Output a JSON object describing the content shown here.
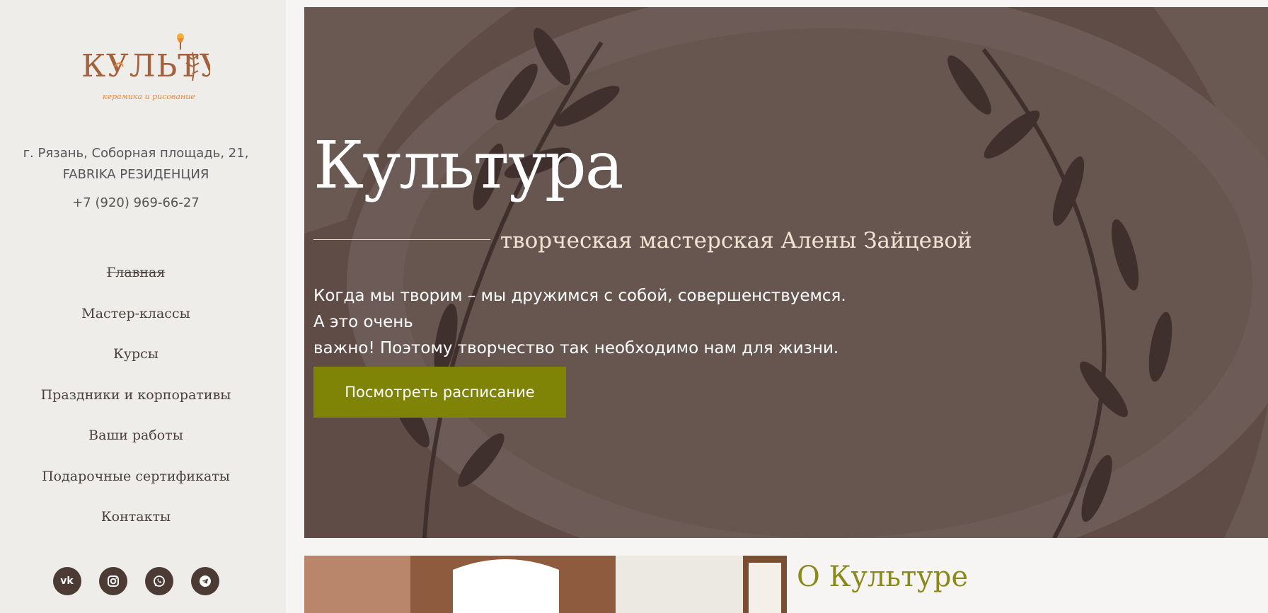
{
  "logo": {
    "text": "КУЛЬТУРА",
    "tagline": "керамика и рисование",
    "colors": {
      "main": "#a3623c",
      "tagline": "#e8893c",
      "accent": "#f2b134"
    }
  },
  "contacts": {
    "address_line1": "г. Рязань, Соборная площадь, 21,",
    "address_line2": "FABRIKA РЕЗИДЕНЦИЯ",
    "phone": "+7 (920) 969-66-27"
  },
  "nav": {
    "items": [
      {
        "label": "Главная",
        "active": true
      },
      {
        "label": "Мастер-классы",
        "active": false
      },
      {
        "label": "Курсы",
        "active": false
      },
      {
        "label": "Праздники и корпоративы",
        "active": false
      },
      {
        "label": "Ваши работы",
        "active": false
      },
      {
        "label": "Подарочные сертификаты",
        "active": false
      },
      {
        "label": "Контакты",
        "active": false
      }
    ]
  },
  "socials": [
    {
      "name": "vk-icon",
      "glyph": "vk"
    },
    {
      "name": "instagram-icon",
      "glyph": ""
    },
    {
      "name": "whatsapp-icon",
      "glyph": ""
    },
    {
      "name": "telegram-icon",
      "glyph": ""
    }
  ],
  "hero": {
    "title": "Культура",
    "subtitle": "творческая мастерская Алены Зайцевой",
    "text_line1": "Когда мы творим – мы дружимся с собой, совершенствуемся. А это очень",
    "text_line2": "важно! Поэтому творчество так необходимо нам для жизни.",
    "button_label": "Посмотреть расписание",
    "colors": {
      "overlay": "#5d4b46",
      "button": "#7f8306",
      "subtitle": "#f0e3d2"
    }
  },
  "about": {
    "heading": "О Культуре",
    "color": "#8a8a1a"
  }
}
